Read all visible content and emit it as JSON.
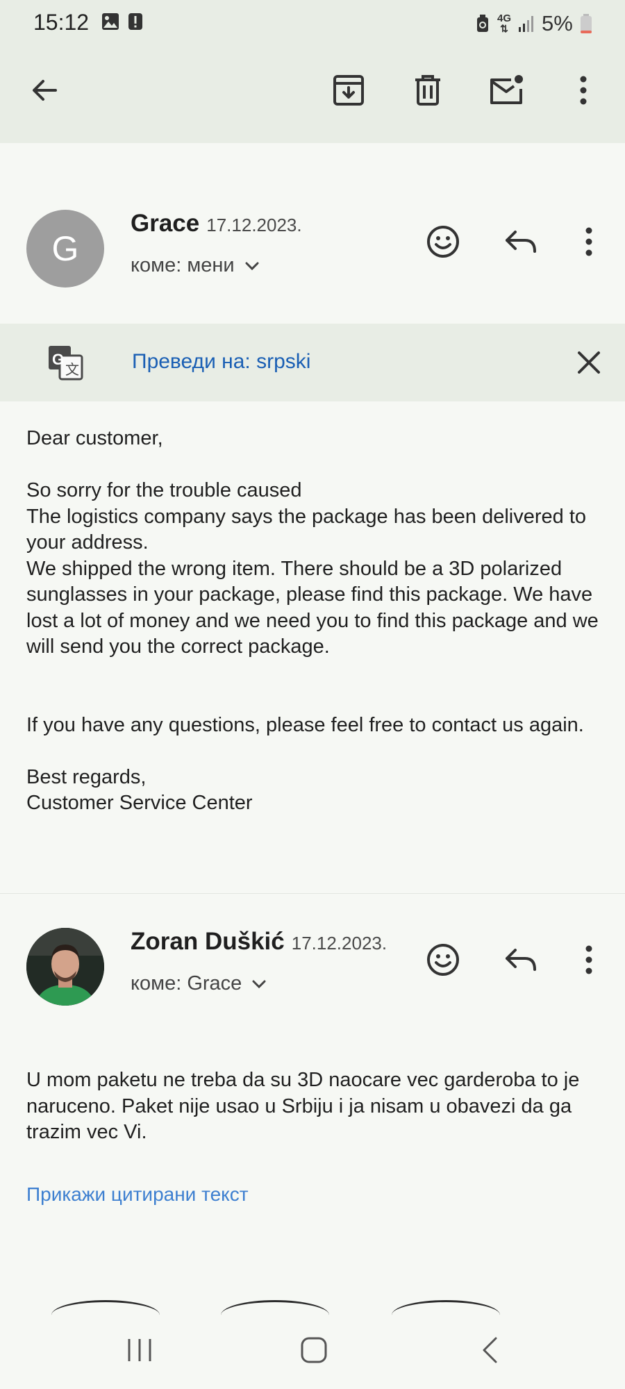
{
  "status_bar": {
    "time": "15:12",
    "network": "4G",
    "battery": "5%"
  },
  "toolbar": {
    "icons": [
      "back-arrow-icon",
      "archive-icon",
      "delete-icon",
      "mark-unread-icon",
      "more-vert-icon"
    ]
  },
  "message1": {
    "avatar_letter": "G",
    "sender": "Grace",
    "date": "17.12.2023.",
    "recipient": "коме: мени",
    "body": "Dear customer,\n\nSo sorry for the trouble caused\nThe logistics company says the package has been delivered to your address.\nWe shipped the wrong item. There should be a 3D polarized sunglasses in your package, please find this package. We have lost a lot of money and we need you to find this package and we will send you the correct package.\n\n\nIf you have any questions, please feel free to contact us again.\n\nBest regards,\nCustomer Service Center"
  },
  "translate": {
    "label": "Преведи на: srpski"
  },
  "message2": {
    "sender": "Zoran Duškić",
    "date": "17.12.2023.",
    "recipient": "коме: Grace",
    "body": "U mom paketu ne treba da su 3D naocare vec garderoba to je naruceno. Paket nije usao u Srbiju i ja nisam u obavezi da ga trazim vec Vi.",
    "show_quoted": "Прикажи цитирани текст"
  },
  "colors": {
    "background": "#f6f8f4",
    "header": "#e8ede5",
    "link": "#1a5fb4",
    "avatar_grey": "#9e9e9e"
  }
}
